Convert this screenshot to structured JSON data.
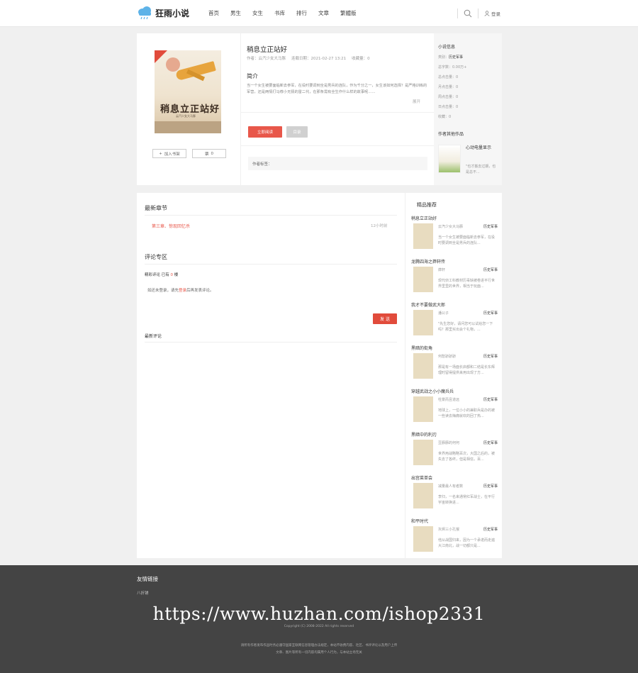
{
  "header": {
    "logo_text": "狂雨小说",
    "nav": [
      "首页",
      "男生",
      "女生",
      "书库",
      "排行",
      "文章",
      "繁體版"
    ],
    "login_label": "登录"
  },
  "book": {
    "title": "稍息立正站好",
    "cover_title": "稍息立正站好",
    "cover_subtitle": "云汽少女大马豚",
    "author": "作者：云汽少女大马豚",
    "created": "连载日期：2021-02-27 13:21",
    "bookmarks": "收藏量：0",
    "intro_heading": "简介",
    "intro_text": "当一个女生被要面临新去参军，在役时要调到全是男兵的连队，作为千分之一，女生该如何选择？是严格训练的军营，还是两情打马荐小无猜的雷二代，在那条需有全生作什么样的故事呢……",
    "unfold": "展开",
    "shelf_label": "加入书架",
    "vote_label": "票",
    "vote_count": "0",
    "read_label": "立即阅读",
    "catalog_label": "目录",
    "tags_label": "作者标签："
  },
  "novel_info": {
    "heading": "小说信息",
    "category_label": "类别：",
    "category": "历史军事",
    "rows": [
      "总字数：0.00万+",
      "总点击量：0",
      "月点击量：0",
      "周点击量：0",
      "日点击量：0",
      "收藏：0"
    ]
  },
  "other_works": {
    "heading": "作者其他作品",
    "title": "心动电量显示",
    "desc": "\"也才搬去过期，也是总不..."
  },
  "latest_chapter": {
    "heading": "最新章节",
    "link": "第三章、惊现回忆杀",
    "time": "12小时前"
  },
  "comments": {
    "heading": "评论专区",
    "stats_prefix": "精彩评论 已有",
    "stats_count": "0",
    "stats_suffix": "楼",
    "login_prefix": "如还未登录，请先",
    "login_link": "登录",
    "login_suffix": "后再发表评论。",
    "send_label": "发 送",
    "latest_heading": "最新评论"
  },
  "recommend": {
    "heading": "精品推荐",
    "items": [
      {
        "title": "稍息立正站好",
        "author": "云汽少女大马豚",
        "genre": "历史军事",
        "desc": "当一个女生被要面临新去参军，在役时要调到全是男兵的连队..."
      },
      {
        "title": "龙腾四海之莽轩传",
        "author": "莽轩",
        "genre": "历史军事",
        "desc": "现代侦工科教材历毒缺被卷进平行世界里里的世界，相当于玩面..."
      },
      {
        "title": "我才不要做武大郎",
        "author": "潘公子",
        "genre": "历史军事",
        "desc": "\"先生您好，请问您可以试给您一下吗？那里买出会个礼物，..."
      },
      {
        "title": "黑暗的街角",
        "author": "何愁骄骄骄",
        "genre": "历史军事",
        "desc": "那是有一场面长启都和二结是长东辉理时留得提供来用出现了方..."
      },
      {
        "title": "穿越武战之小小魔兵兵",
        "author": "柱景而且道远",
        "genre": "历史军事",
        "desc": "地球上，一位小小的兼职兵是办的被一些读去梅痛就欢的回了热..."
      },
      {
        "title": "黑暗中的利刃",
        "author": "豆豚豚的何何",
        "genre": "历史军事",
        "desc": "世界用战略略百次，大国之后的，被失去了各终，但是相信，百..."
      },
      {
        "title": "出宫菜单会",
        "author": "减量最人有者数",
        "genre": "历史军事",
        "desc": "李归，一名来通常红军战士，在平行宇宙转换进..."
      },
      {
        "title": "和平时代",
        "author": "灰烬三小孔猴",
        "genre": "历史军事",
        "desc": "他从战国归来，因为一个承诺而走遍大江南北，战一切都只是..."
      }
    ]
  },
  "footer": {
    "links_heading": "友情链接",
    "link": "八折铺",
    "watermark": "https://www.huzhan.com/ishop2331",
    "copyright": "Copyright (C) 2008-2022 All rights reserved",
    "disclaimer_1": "请所有作者发布作品时务必遵守国家互联网信息管理办法规定，本站不收费内容、社区、书评评论以及用户上传",
    "disclaimer_2": "文章、图片等所有一切内容均属用个人行为，与本站立场无关"
  }
}
